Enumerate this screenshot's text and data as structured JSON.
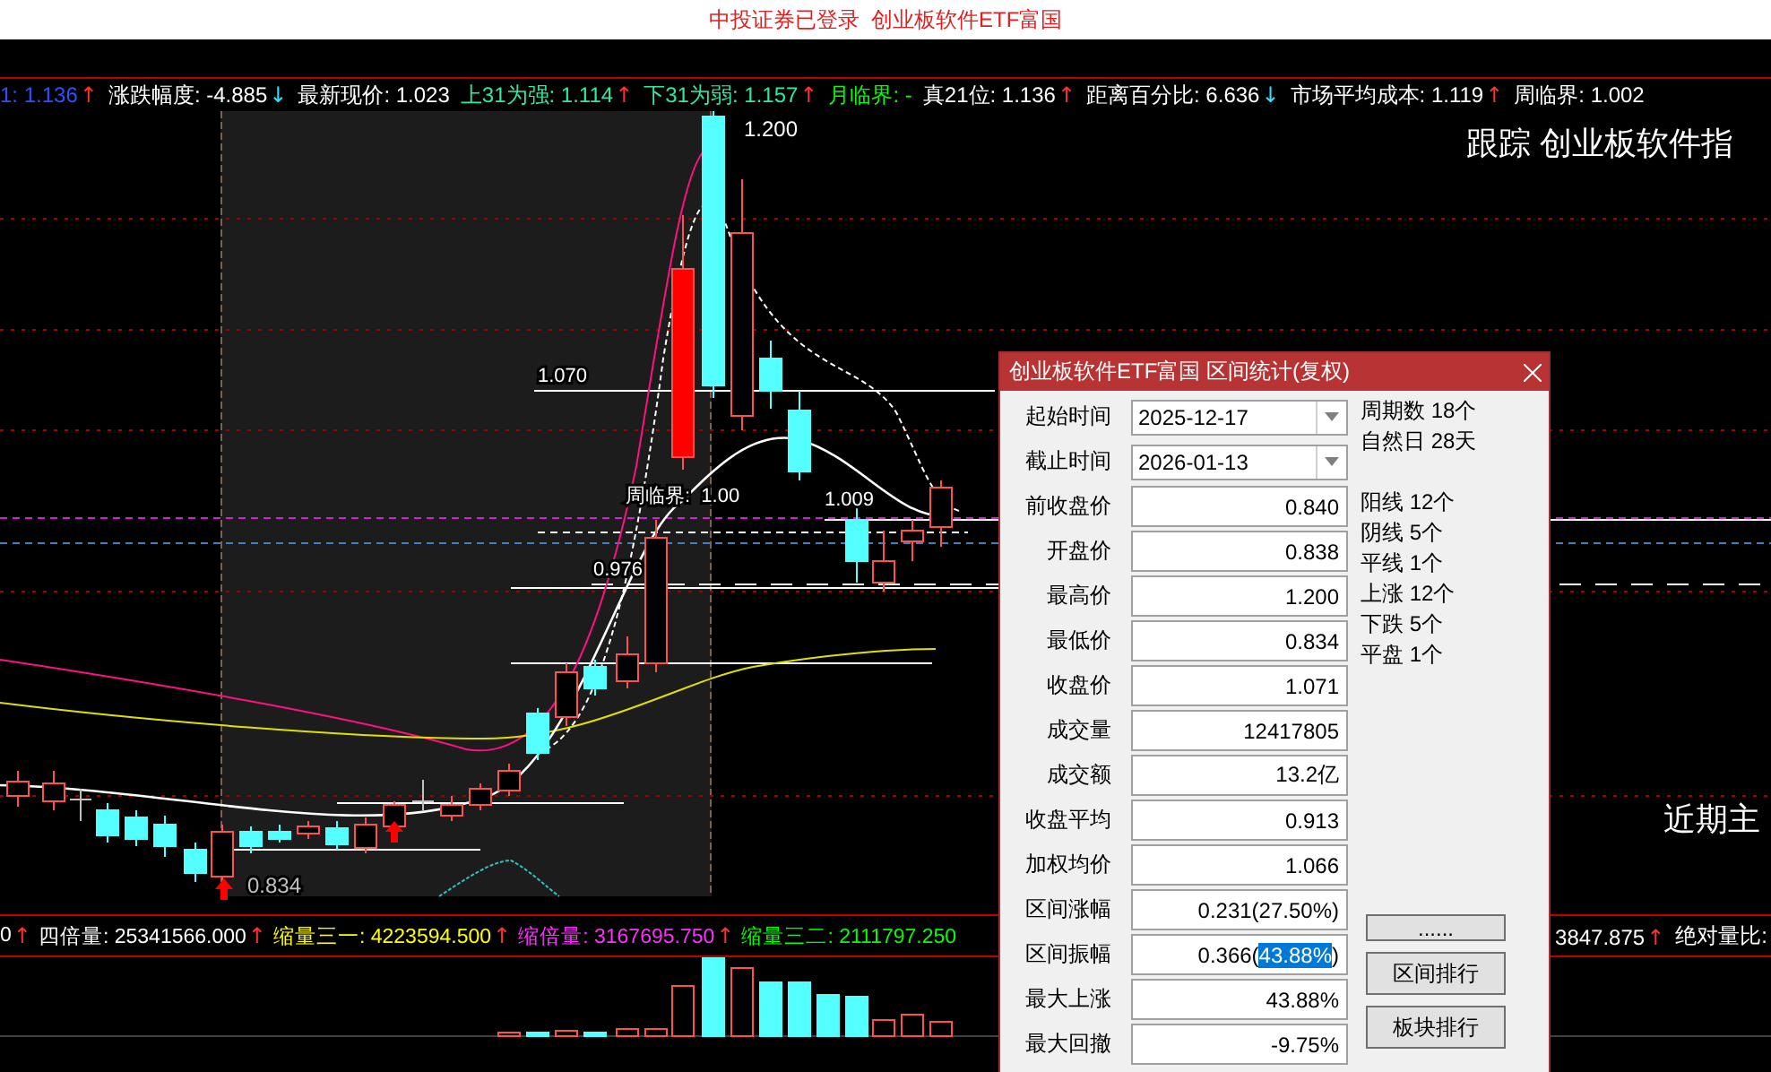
{
  "window": {
    "title": "中投证券已登录  创业板软件ETF富国"
  },
  "indicators": [
    {
      "text": "1: 1.136",
      "color": "#3050ff",
      "arrow": "↑",
      "kind": "rising"
    },
    {
      "text": "涨跌幅度: -4.885",
      "color": "#ffffff",
      "arrow": "↓",
      "kind": "falling"
    },
    {
      "text": "最新现价: 1.023",
      "color": "#ffffff"
    },
    {
      "text": "上31为强: 1.114",
      "color": "#30e8a0",
      "arrow": "↑",
      "kind": "rising"
    },
    {
      "text": "下31为弱: 1.157",
      "color": "#30e8a0",
      "arrow": "↑",
      "kind": "rising"
    },
    {
      "text": "月临界: -",
      "color": "#00ff00"
    },
    {
      "text": "真21位: 1.136",
      "color": "#ffffff",
      "arrow": "↑",
      "kind": "rising"
    },
    {
      "text": "距离百分比: 6.636",
      "color": "#ffffff",
      "arrow": "↓",
      "kind": "falling"
    },
    {
      "text": "市场平均成本: 1.119",
      "color": "#ffffff",
      "arrow": "↑",
      "kind": "rising"
    },
    {
      "text": "周临界: 1.002",
      "color": "#ffffff"
    }
  ],
  "chart_labels": [
    {
      "text": "1.200",
      "kind": "price"
    },
    {
      "text": "1.070",
      "kind": "price"
    },
    {
      "text": "周临界:  1.00",
      "kind": "price"
    },
    {
      "text": "1.009",
      "kind": "price"
    },
    {
      "text": "0.976",
      "kind": "price"
    },
    {
      "text": "0.834",
      "kind": "price"
    },
    {
      "text": "跟踪 创业板软件指",
      "kind": "banner"
    },
    {
      "text": "近期主",
      "kind": "banner"
    }
  ],
  "volume_indicators": [
    {
      "text": "0",
      "color": "#ffffff",
      "arrow": "↑",
      "kind": "rising"
    },
    {
      "text": "四倍量: 25341566.000",
      "color": "#ffffff",
      "arrow": "↑",
      "kind": "rising"
    },
    {
      "text": "缩量三一: 4223594.500",
      "color": "#ffff00",
      "arrow": "↑",
      "kind": "rising"
    },
    {
      "text": "缩倍量: 3167695.750",
      "color": "#ff30ff",
      "arrow": "↑",
      "kind": "rising"
    },
    {
      "text": "缩量三二: 2111797.250",
      "color": "#00ff00"
    }
  ],
  "volume_indicators_right": [
    {
      "text": "3847.875",
      "color": "#ffffff",
      "arrow": "↑",
      "kind": "rising"
    },
    {
      "text": "绝对量比:",
      "color": "#ffffff"
    }
  ],
  "dialog": {
    "title": "创业板软件ETF富国 区间统计(复权)",
    "fields": [
      {
        "label": "起始时间",
        "value": "2025-12-17",
        "kind": "combo"
      },
      {
        "label": "截止时间",
        "value": "2026-01-13",
        "kind": "combo"
      },
      {
        "label": "前收盘价",
        "value": "0.840",
        "kind": "text"
      },
      {
        "label": "开盘价",
        "value": "0.838",
        "kind": "text"
      },
      {
        "label": "最高价",
        "value": "1.200",
        "kind": "text"
      },
      {
        "label": "最低价",
        "value": "0.834",
        "kind": "text"
      },
      {
        "label": "收盘价",
        "value": "1.071",
        "kind": "text"
      },
      {
        "label": "成交量",
        "value": "12417805",
        "kind": "text"
      },
      {
        "label": "成交额",
        "value": "13.2亿",
        "kind": "text"
      },
      {
        "label": "收盘平均",
        "value": "0.913",
        "kind": "text"
      },
      {
        "label": "加权均价",
        "value": "1.066",
        "kind": "text"
      },
      {
        "label": "区间涨幅",
        "value": "0.231(27.50%)",
        "kind": "text"
      },
      {
        "label": "区间振幅",
        "value": "0.366(",
        "highlight": "43.88%",
        "tail": ")",
        "kind": "selection"
      },
      {
        "label": "最大上涨",
        "value": "43.88%",
        "kind": "text"
      },
      {
        "label": "最大回撤",
        "value": "-9.75%",
        "kind": "text"
      }
    ],
    "summary_top": [
      "周期数 18个",
      "自然日 28天"
    ],
    "summary": [
      "阳线 12个",
      "阴线 5个",
      "平线 1个",
      "上涨 12个",
      "下跌 5个",
      "平盘 1个"
    ],
    "buttons": [
      "......",
      "区间排行",
      "板块排行"
    ]
  }
}
